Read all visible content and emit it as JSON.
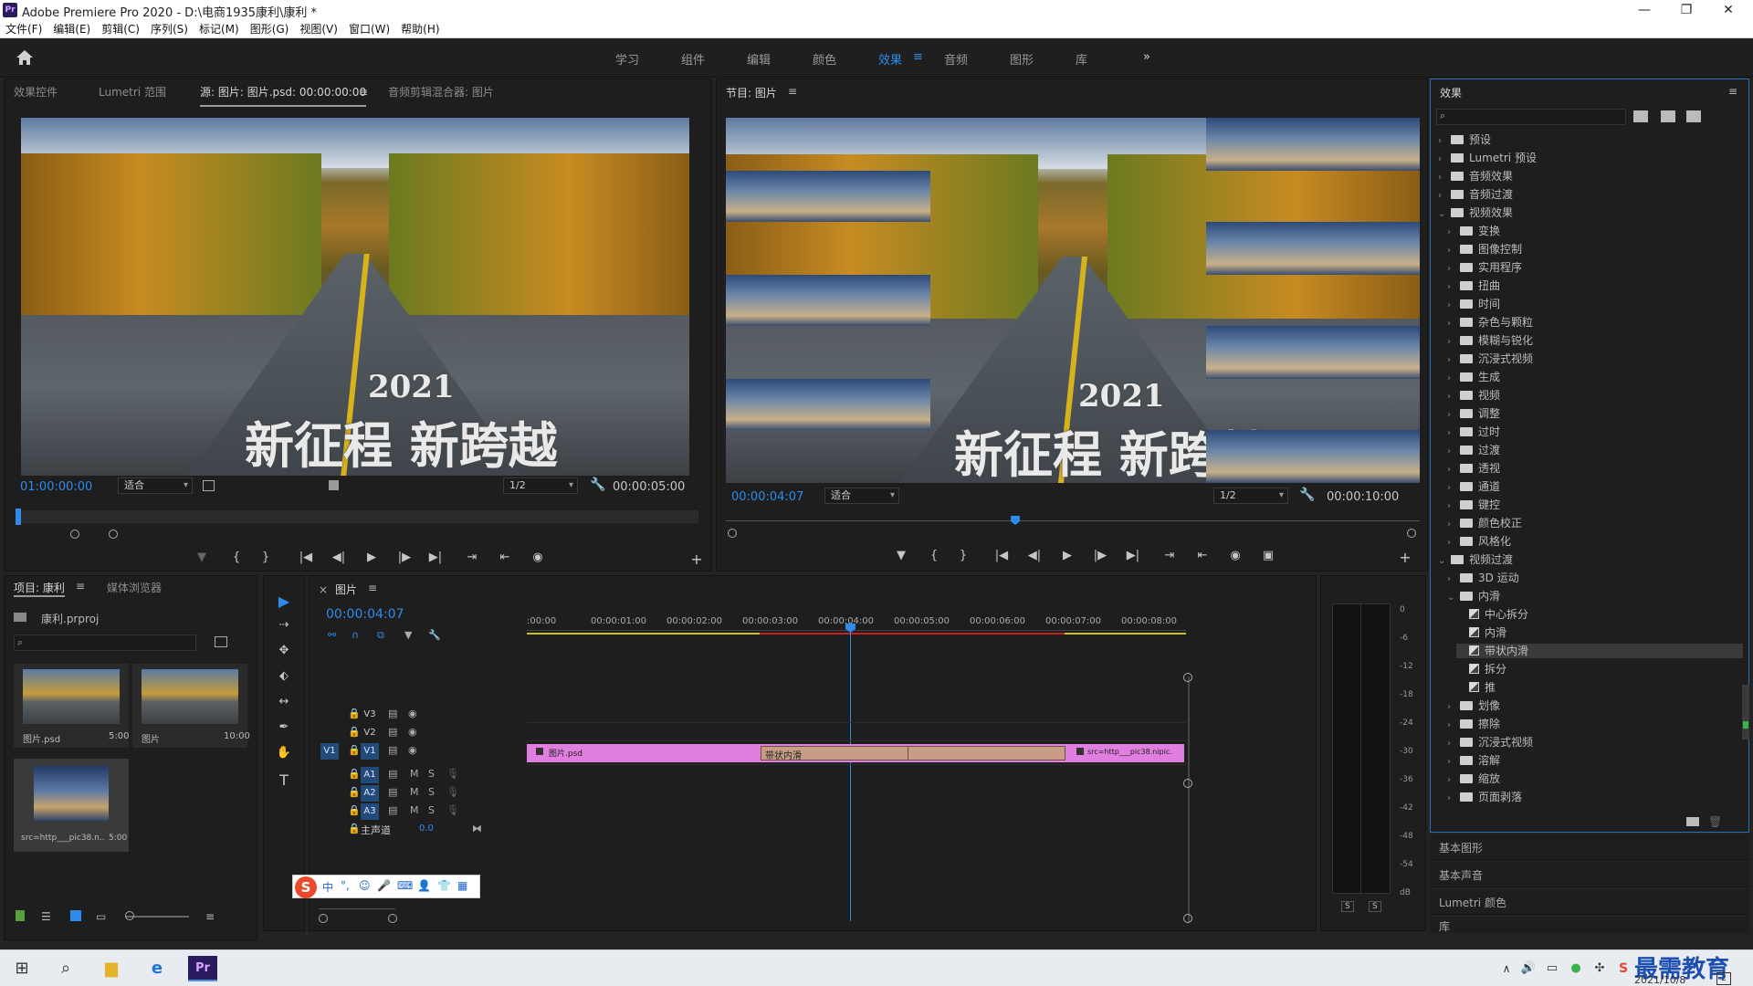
{
  "window": {
    "title": "Adobe Premiere Pro 2020 - D:\\电商1935康利\\康利 *",
    "app_badge": "Pr",
    "minimize": "—",
    "maximize": "❐",
    "close": "✕"
  },
  "menu": [
    "文件(F)",
    "编辑(E)",
    "剪辑(C)",
    "序列(S)",
    "标记(M)",
    "图形(G)",
    "视图(V)",
    "窗口(W)",
    "帮助(H)"
  ],
  "workspaces": {
    "items": [
      "学习",
      "组件",
      "编辑",
      "颜色",
      "效果",
      "音频",
      "图形",
      "库"
    ],
    "active": "效果",
    "more": "»",
    "menu": "≡"
  },
  "source_panel": {
    "tabs": [
      "效果控件",
      "Lumetri 范围",
      "源: 图片: 图片.psd: 00:00:00:00",
      "音频剪辑混合器: 图片"
    ],
    "tab_menu": "≡",
    "overlay_year": "2021",
    "overlay_text": "新征程 新跨越",
    "timecode_in": "01:00:00:00",
    "fit": "适合",
    "resolution": "1/2",
    "duration": "00:00:05:00",
    "add": "+"
  },
  "program_panel": {
    "title": "节目: 图片",
    "menu": "≡",
    "overlay_year": "2021",
    "overlay_text": "新征程 新跨越",
    "timecode": "00:00:04:07",
    "fit": "适合",
    "resolution": "1/2",
    "duration": "00:00:10:00",
    "add": "+"
  },
  "controls": {
    "marker": "▼",
    "in": "{",
    "out": "}",
    "go_in": "|◀",
    "step_back": "◀|",
    "play": "▶",
    "step_fwd": "|▶",
    "go_out": "▶|",
    "lift": "⇥",
    "extract": "⇤",
    "export_frame": "◉",
    "compare": "▣"
  },
  "project_panel": {
    "tabs": [
      "项目: 康利",
      "媒体浏览器"
    ],
    "tab_menu": "≡",
    "project_file": "康利.prproj",
    "search_placeholder": "",
    "items": [
      {
        "name": "图片.psd",
        "duration": "5:00"
      },
      {
        "name": "图片",
        "duration": "10:00"
      },
      {
        "name": "src=http___pic38.n...",
        "duration": "5:00"
      }
    ]
  },
  "tools": [
    "▶",
    "⇢",
    "✥",
    "⬖",
    "↔",
    "✒",
    "✋",
    "T"
  ],
  "timeline": {
    "close": "×",
    "title": "图片",
    "menu": "≡",
    "timecode": "00:00:04:07",
    "ruler": [
      ":00:00",
      "00:00:01:00",
      "00:00:02:00",
      "00:00:03:00",
      "00:00:04:00",
      "00:00:05:00",
      "00:00:06:00",
      "00:00:07:00",
      "00:00:08:00"
    ],
    "tracks": [
      {
        "name": "V3",
        "kind": "video"
      },
      {
        "name": "V2",
        "kind": "video"
      },
      {
        "name": "V1",
        "kind": "video",
        "source": "V1"
      },
      {
        "name": "A1",
        "kind": "audio"
      },
      {
        "name": "A2",
        "kind": "audio"
      },
      {
        "name": "A3",
        "kind": "audio"
      }
    ],
    "mute": "M",
    "solo": "S",
    "master": {
      "label": "主声道",
      "value": "0.0"
    },
    "clips": {
      "clip1": "图片.psd",
      "transition": "带状内滑",
      "clip2": "src=http___pic38.nipic."
    }
  },
  "audio_meter": {
    "scale": [
      "0",
      "-6",
      "-12",
      "-18",
      "-24",
      "-30",
      "-36",
      "-42",
      "-48",
      "-54",
      "dB"
    ],
    "solo": [
      "S",
      "S"
    ]
  },
  "effects_panel": {
    "title": "效果",
    "menu": "≡",
    "tree": [
      {
        "label": "预设",
        "level": 0,
        "type": "folder",
        "open": false
      },
      {
        "label": "Lumetri 预设",
        "level": 0,
        "type": "folder",
        "open": false
      },
      {
        "label": "音频效果",
        "level": 0,
        "type": "folder",
        "open": false
      },
      {
        "label": "音频过渡",
        "level": 0,
        "type": "folder",
        "open": false
      },
      {
        "label": "视频效果",
        "level": 0,
        "type": "folder",
        "open": true
      },
      {
        "label": "变换",
        "level": 1,
        "type": "folder",
        "open": false
      },
      {
        "label": "图像控制",
        "level": 1,
        "type": "folder",
        "open": false
      },
      {
        "label": "实用程序",
        "level": 1,
        "type": "folder",
        "open": false
      },
      {
        "label": "扭曲",
        "level": 1,
        "type": "folder",
        "open": false
      },
      {
        "label": "时间",
        "level": 1,
        "type": "folder",
        "open": false
      },
      {
        "label": "杂色与颗粒",
        "level": 1,
        "type": "folder",
        "open": false
      },
      {
        "label": "模糊与锐化",
        "level": 1,
        "type": "folder",
        "open": false
      },
      {
        "label": "沉浸式视频",
        "level": 1,
        "type": "folder",
        "open": false
      },
      {
        "label": "生成",
        "level": 1,
        "type": "folder",
        "open": false
      },
      {
        "label": "视频",
        "level": 1,
        "type": "folder",
        "open": false
      },
      {
        "label": "调整",
        "level": 1,
        "type": "folder",
        "open": false
      },
      {
        "label": "过时",
        "level": 1,
        "type": "folder",
        "open": false
      },
      {
        "label": "过渡",
        "level": 1,
        "type": "folder",
        "open": false
      },
      {
        "label": "透视",
        "level": 1,
        "type": "folder",
        "open": false
      },
      {
        "label": "通道",
        "level": 1,
        "type": "folder",
        "open": false
      },
      {
        "label": "键控",
        "level": 1,
        "type": "folder",
        "open": false
      },
      {
        "label": "颜色校正",
        "level": 1,
        "type": "folder",
        "open": false
      },
      {
        "label": "风格化",
        "level": 1,
        "type": "folder",
        "open": false
      },
      {
        "label": "视频过渡",
        "level": 0,
        "type": "folder",
        "open": true
      },
      {
        "label": "3D 运动",
        "level": 1,
        "type": "folder",
        "open": false
      },
      {
        "label": "内滑",
        "level": 1,
        "type": "folder",
        "open": true
      },
      {
        "label": "中心拆分",
        "level": 2,
        "type": "fx"
      },
      {
        "label": "内滑",
        "level": 2,
        "type": "fx"
      },
      {
        "label": "带状内滑",
        "level": 2,
        "type": "fx",
        "selected": true
      },
      {
        "label": "拆分",
        "level": 2,
        "type": "fx"
      },
      {
        "label": "推",
        "level": 2,
        "type": "fx"
      },
      {
        "label": "划像",
        "level": 1,
        "type": "folder",
        "open": false
      },
      {
        "label": "擦除",
        "level": 1,
        "type": "folder",
        "open": false
      },
      {
        "label": "沉浸式视频",
        "level": 1,
        "type": "folder",
        "open": false
      },
      {
        "label": "溶解",
        "level": 1,
        "type": "folder",
        "open": false
      },
      {
        "label": "缩放",
        "level": 1,
        "type": "folder",
        "open": false
      },
      {
        "label": "页面剥落",
        "level": 1,
        "type": "folder",
        "open": false
      }
    ],
    "bottom_sections": [
      "基本图形",
      "基本声音",
      "Lumetri 颜色",
      "库"
    ]
  },
  "ime_bar": {
    "items": [
      "中",
      "°,",
      "☺",
      "🎤",
      "⌨",
      "👤",
      "👕",
      "▦"
    ]
  },
  "taskbar": {
    "watermark": "最需教育",
    "date": "2021/10/8",
    "notify_count": "2"
  }
}
